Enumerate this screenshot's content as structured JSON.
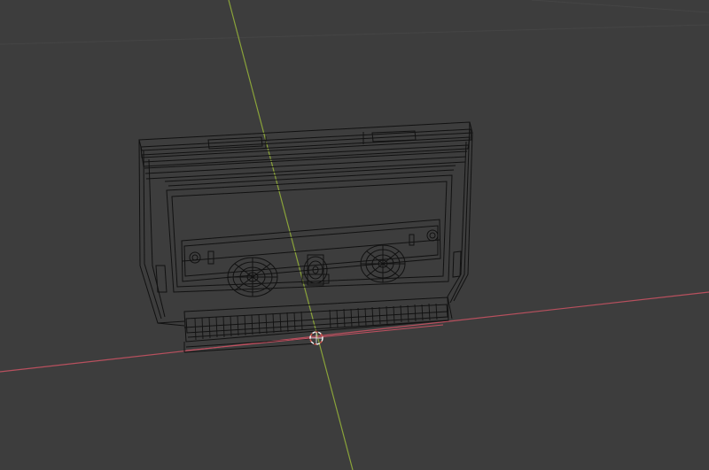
{
  "viewport": {
    "mode": "Wireframe",
    "background_color": "#3d3d3d"
  },
  "axes": {
    "x_axis_color": "#b8505e",
    "y_axis_color": "#8aa33a"
  },
  "object": {
    "name": "cassette-tape",
    "wire_color": "#111111"
  },
  "origin_marker": {
    "color": "#f2f2f2",
    "accent": "#d0544a"
  }
}
